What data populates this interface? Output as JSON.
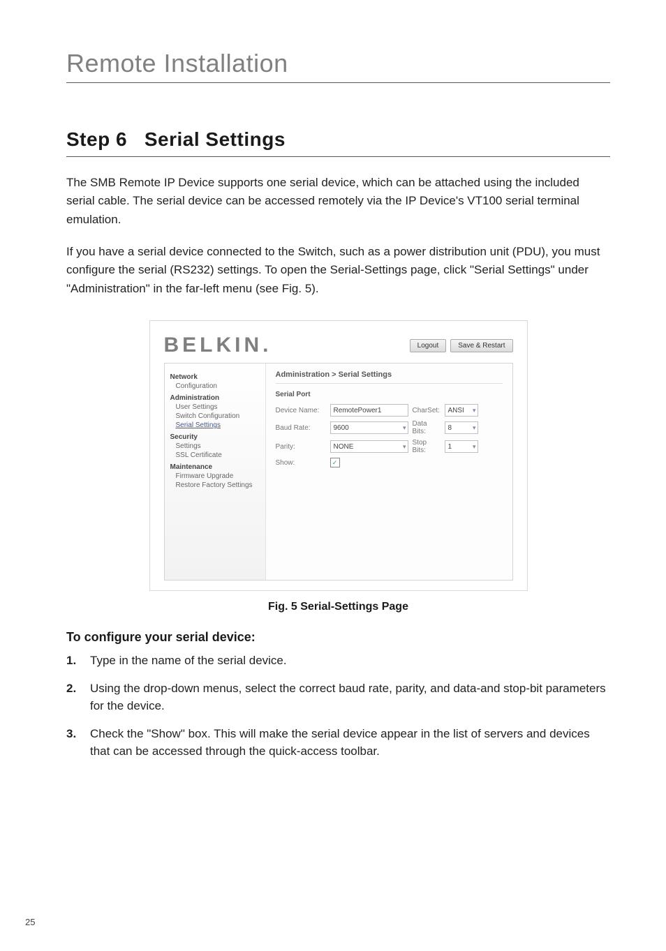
{
  "page": {
    "split_title": "Remote Installation",
    "page_number": "25"
  },
  "heading": {
    "step_label": "Step 6",
    "step_title": "Serial Settings"
  },
  "para1": "The SMB Remote IP Device supports one serial device, which can be attached using the included serial cable. The serial device can be accessed remotely via the IP Device's VT100 serial terminal emulation.",
  "para2": "If you have a serial device connected to the Switch, such as a power distribution unit (PDU), you must configure the serial (RS232) settings. To open the Serial-Settings page, click \"Serial Settings\" under \"Administration\" in the far-left menu (see Fig. 5).",
  "figure": {
    "brand": "BELKIN.",
    "buttons": {
      "logout": "Logout",
      "save_restart": "Save & Restart"
    },
    "sidebar": {
      "network": {
        "title": "Network",
        "items": [
          "Configuration"
        ]
      },
      "administration": {
        "title": "Administration",
        "items": [
          "User Settings",
          "Switch Configuration",
          "Serial Settings"
        ]
      },
      "security": {
        "title": "Security",
        "items": [
          "Settings",
          "SSL Certificate"
        ]
      },
      "maintenance": {
        "title": "Maintenance",
        "items": [
          "Firmware Upgrade",
          "Restore Factory Settings"
        ]
      }
    },
    "breadcrumb": "Administration > Serial Settings",
    "section_label": "Serial Port",
    "form": {
      "device_name_label": "Device Name:",
      "device_name_value": "RemotePower1",
      "charset_label": "CharSet:",
      "charset_value": "ANSI",
      "baud_label": "Baud Rate:",
      "baud_value": "9600",
      "data_bits_label": "Data Bits:",
      "data_bits_value": "8",
      "parity_label": "Parity:",
      "parity_value": "NONE",
      "stop_bits_label": "Stop Bits:",
      "stop_bits_value": "1",
      "show_label": "Show:",
      "show_checked": "✓"
    },
    "caption": "Fig. 5 Serial-Settings Page"
  },
  "subhead": "To configure your serial device:",
  "steps": [
    "Type in the name of the serial device.",
    "Using the drop-down menus, select the correct baud rate, parity, and data-and stop-bit parameters for the device.",
    "Check the \"Show\" box. This will make the serial device appear in the list of servers and devices that can be accessed through the quick-access toolbar."
  ]
}
